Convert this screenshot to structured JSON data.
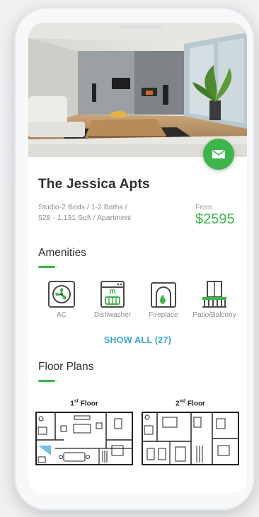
{
  "listing": {
    "name": "The Jessica Apts",
    "specs_line1": "Studio-2 Beds / 1-2 Baths /",
    "specs_line2": "528 - 1,131 Sqft / Apartment",
    "from_label": "From",
    "price": "$2595"
  },
  "contact_button": {
    "icon": "mail-icon",
    "color": "#3cb64a"
  },
  "amenities": {
    "title": "Amenities",
    "items": [
      {
        "label": "AC",
        "icon": "ac-fan-icon"
      },
      {
        "label": "Dishwasher",
        "icon": "dishwasher-icon"
      },
      {
        "label": "Fireplace",
        "icon": "fireplace-icon"
      },
      {
        "label": "Patio/Balcony",
        "icon": "balcony-icon"
      }
    ],
    "show_all": "SHOW ALL (27)"
  },
  "floor_plans": {
    "title": "Floor Plans",
    "plans": [
      {
        "floor_num": "1",
        "floor_sup": "st",
        "floor_word": " Floor"
      },
      {
        "floor_num": "2",
        "floor_sup": "nd",
        "floor_word": " Floor"
      }
    ]
  },
  "colors": {
    "accent_green": "#3cb64a",
    "link_blue": "#35a6d8"
  }
}
